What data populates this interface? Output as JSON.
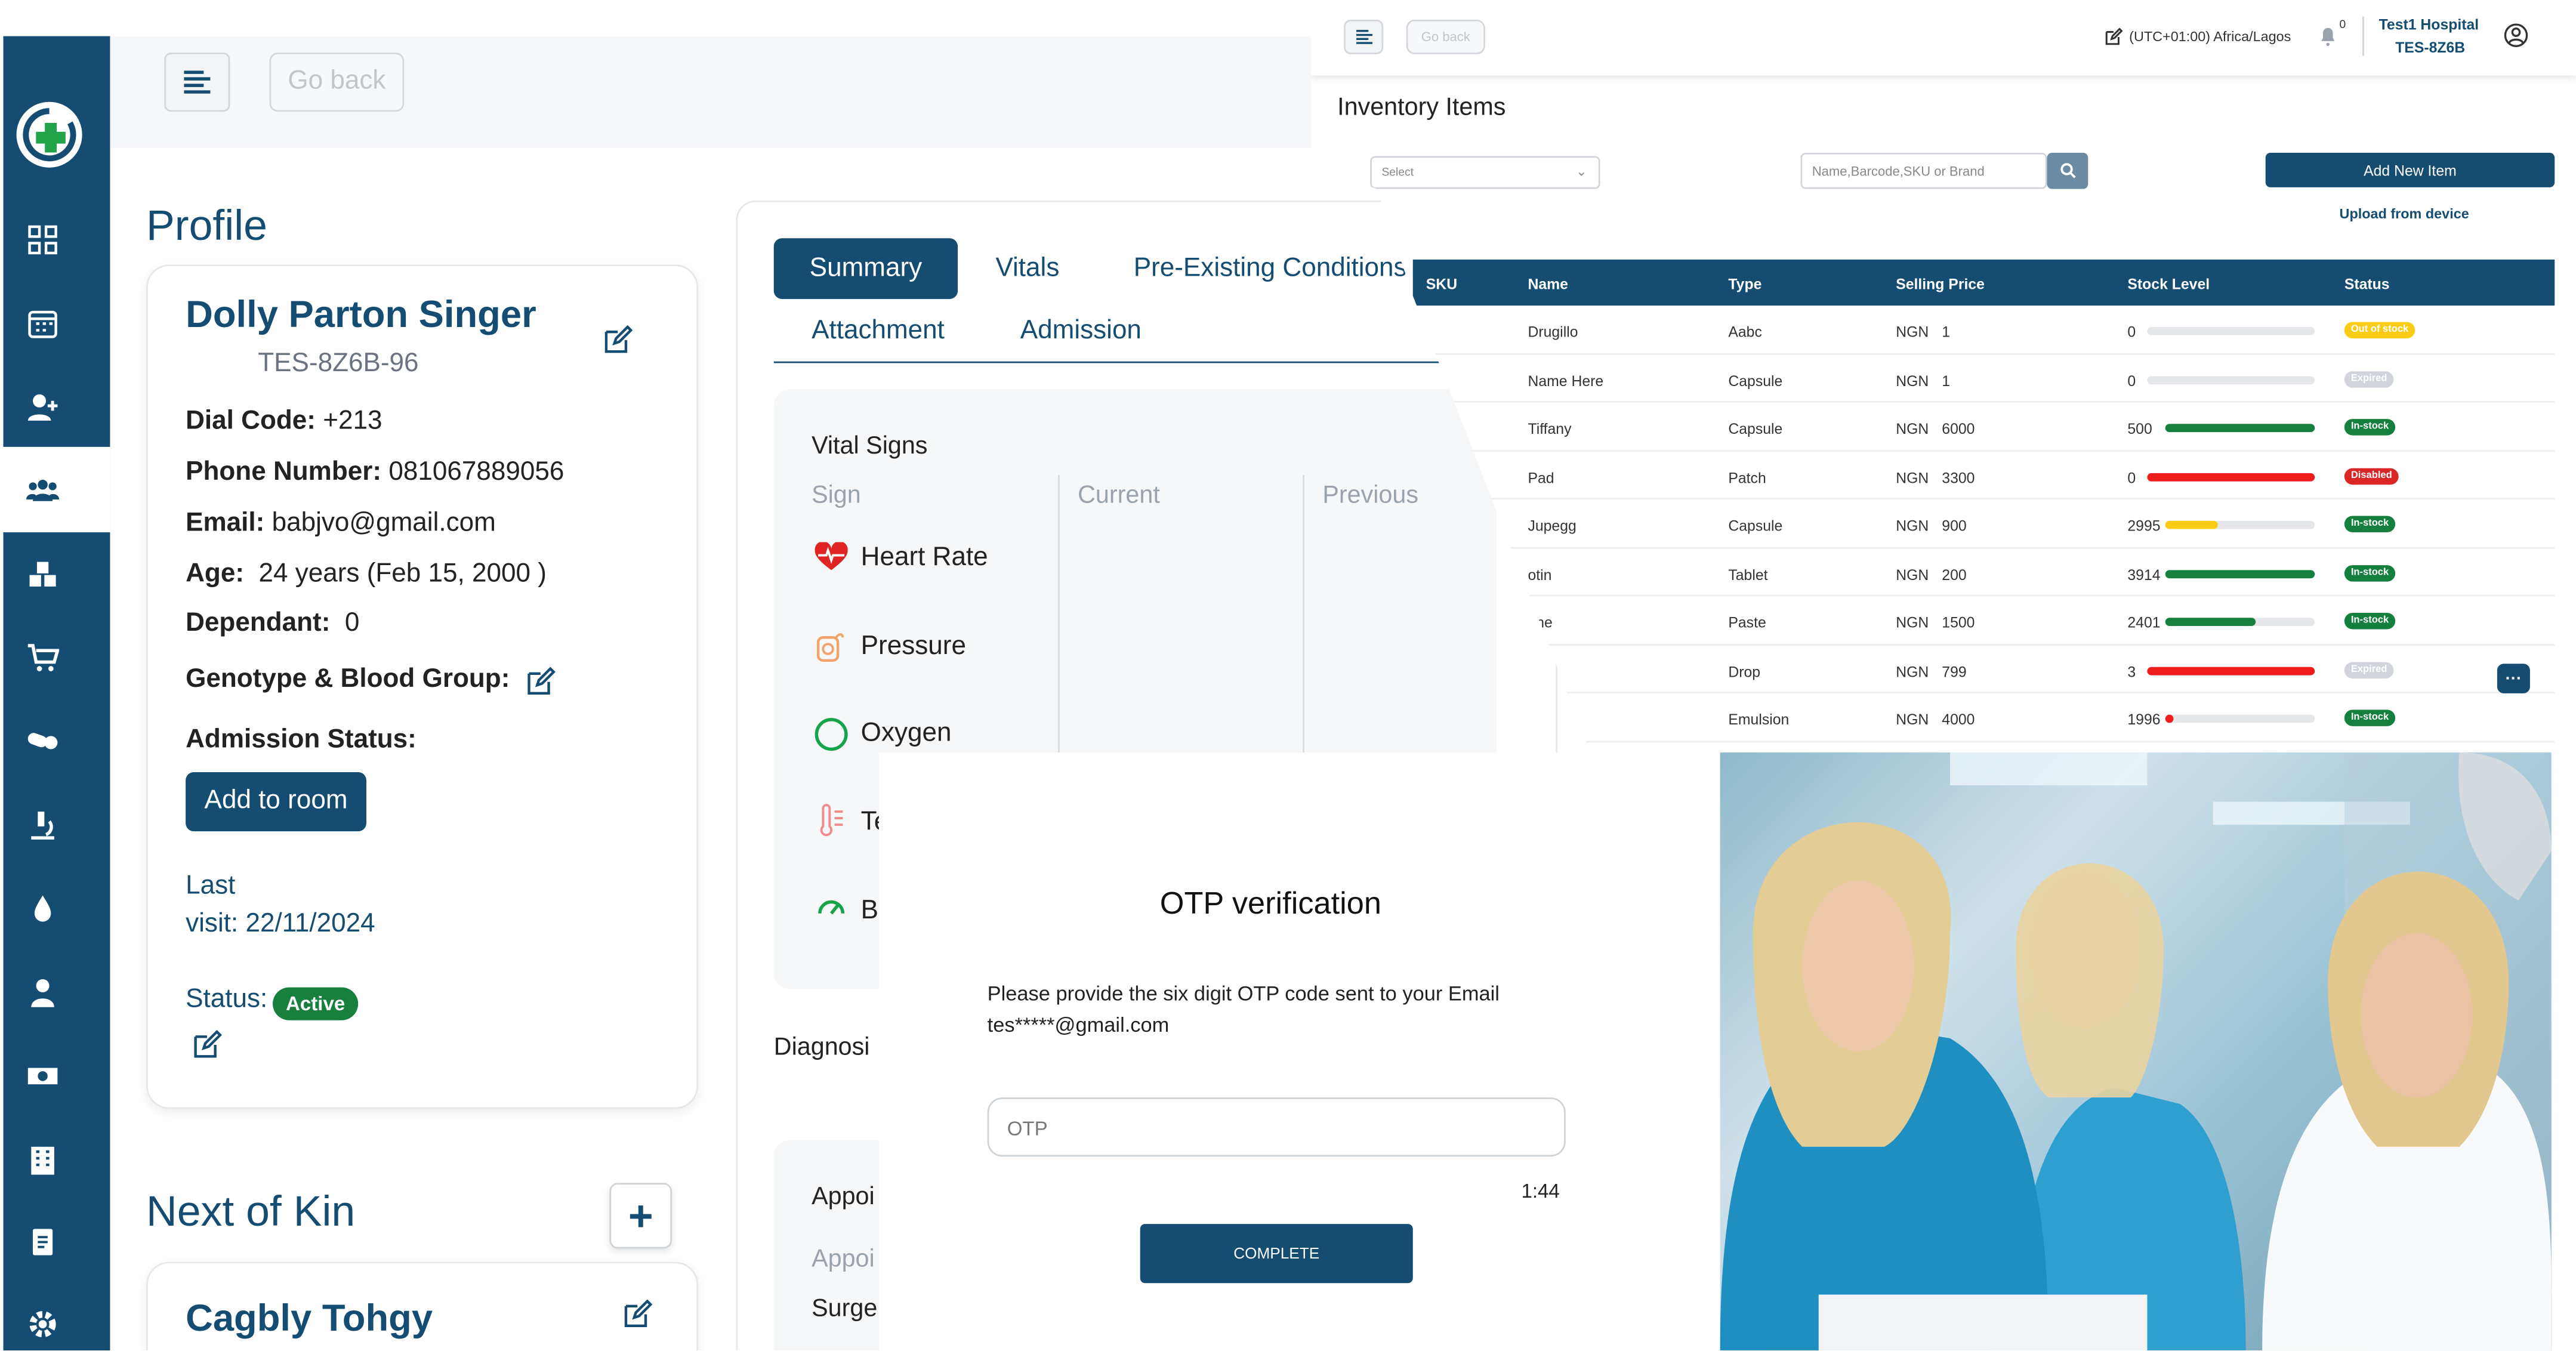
{
  "topbar": {
    "go_back": "Go back"
  },
  "profile": {
    "title": "Profile",
    "name": "Dolly Parton Singer",
    "id": "TES-8Z6B-96",
    "dial_code_label": "Dial Code:",
    "dial_code": "+213",
    "phone_label": "Phone Number:",
    "phone": "081067889056",
    "email_label": "Email:",
    "email": "babjvo@gmail.com",
    "age_label": "Age:",
    "age": "24 years (Feb 15, 2000 )",
    "dependant_label": "Dependant:",
    "dependant": "0",
    "genotype_label": "Genotype & Blood Group:",
    "admission_label": "Admission Status:",
    "add_room": "Add to room",
    "last_visit_1": "Last",
    "last_visit_2": "visit: 22/11/2024",
    "status_label": "Status:",
    "status": "Active"
  },
  "kin": {
    "title": "Next of Kin",
    "add": "+",
    "name": "Cagbly Tohgy"
  },
  "tabs": [
    "Summary",
    "Vitals",
    "Pre-Existing Conditions",
    "Attachment",
    "Admission"
  ],
  "vitals": {
    "title": "Vital Signs",
    "cols": [
      "Sign",
      "Current",
      "Previous"
    ],
    "signs": [
      "Heart Rate",
      "Pressure",
      "Oxygen",
      "Te",
      "B"
    ]
  },
  "sections": {
    "diagnosis": "Diagnosi",
    "appoint": "Appoi",
    "appoint_sub": "Appoi",
    "surge": "Surge"
  },
  "inventory": {
    "header": {
      "go_back": "Go back",
      "timezone": "(UTC+01:00) Africa/Lagos",
      "notif_count": "0",
      "hospital": "Test1 Hospital",
      "hospital_id": "TES-8Z6B"
    },
    "title": "Inventory Items",
    "select_placeholder": "Select",
    "search_placeholder": "Name,Barcode,SKU or Brand",
    "add_new": "Add New Item",
    "upload": "Upload from device",
    "columns": [
      "SKU",
      "Name",
      "Type",
      "Selling Price",
      "Stock Level",
      "Status"
    ],
    "rows": [
      {
        "name": "Drugillo",
        "type": "Aabc",
        "currency": "NGN",
        "price": "1",
        "stock": "0",
        "level": 0,
        "color": "#e5e7eb",
        "status": "Out of stock",
        "status_color": "#facc15"
      },
      {
        "name": "Name Here",
        "type": "Capsule",
        "currency": "NGN",
        "price": "1",
        "stock": "0",
        "level": 0,
        "color": "#e5e7eb",
        "status": "Expired",
        "status_color": "#d1d5db"
      },
      {
        "name": "Tiffany",
        "type": "Capsule",
        "currency": "NGN",
        "price": "6000",
        "stock": "500",
        "level": 1,
        "color": "#15803d",
        "status": "In-stock",
        "status_color": "#15803d"
      },
      {
        "name": "Pad",
        "type": "Patch",
        "currency": "NGN",
        "price": "3300",
        "stock": "0",
        "level": 1,
        "color": "#ef1c1c",
        "status": "Disabled",
        "status_color": "#dc2626"
      },
      {
        "name": "Jupegg",
        "type": "Capsule",
        "currency": "NGN",
        "price": "900",
        "stock": "2995",
        "level": 0.35,
        "color": "#facc15",
        "status": "In-stock",
        "status_color": "#15803d"
      },
      {
        "name": "otin",
        "type": "Tablet",
        "currency": "NGN",
        "price": "200",
        "stock": "3914",
        "level": 1,
        "color": "#15803d",
        "status": "In-stock",
        "status_color": "#15803d"
      },
      {
        "name": "rine",
        "type": "Paste",
        "currency": "NGN",
        "price": "1500",
        "stock": "2401",
        "level": 0.6,
        "color": "#15803d",
        "status": "In-stock",
        "status_color": "#15803d"
      },
      {
        "name": "",
        "type": "Drop",
        "currency": "NGN",
        "price": "799",
        "stock": "3",
        "level": 1,
        "color": "#ef1c1c",
        "status": "Expired",
        "status_color": "#d1d5db"
      },
      {
        "name": "",
        "type": "Emulsion",
        "currency": "NGN",
        "price": "4000",
        "stock": "1996",
        "level": 0.05,
        "color": "#ef1c1c",
        "status": "In-stock",
        "status_color": "#15803d"
      }
    ]
  },
  "otp": {
    "title": "OTP verification",
    "message": "Please provide the six digit OTP code sent to your Email tes*****@gmail.com",
    "placeholder": "OTP",
    "timer": "1:44",
    "button": "COMPLETE"
  },
  "colors": {
    "primary": "#154d72",
    "active": "#16803c"
  }
}
